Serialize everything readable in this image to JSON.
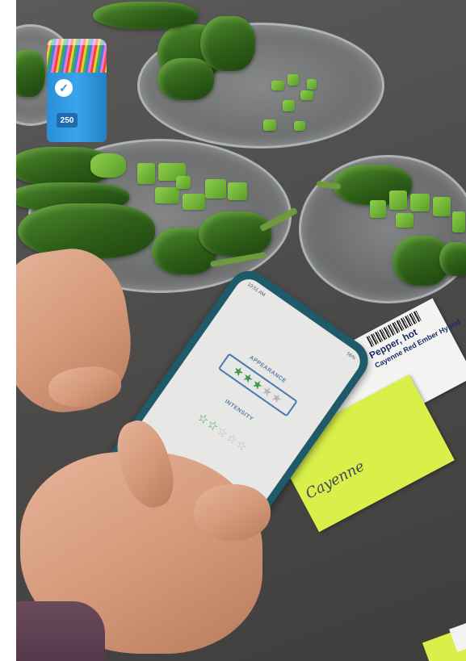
{
  "toothpick_jar": {
    "badge": "250"
  },
  "seed_tag": {
    "title": "Pepper, hot",
    "subtitle": "Cayenne Red Ember Hybrid",
    "handwritten": "Cayenne"
  },
  "phone_app": {
    "status_left": "10:51 AM",
    "status_right": "56%",
    "appearance_label": "APPEARANCE",
    "appearance_rating": 3,
    "appearance_max": 5,
    "intensity_label": "INTENSITY",
    "intensity_rating": 2,
    "intensity_max": 5,
    "star_active_color": "#3b9a4c",
    "star_inactive_color": "#b8b8b8"
  }
}
